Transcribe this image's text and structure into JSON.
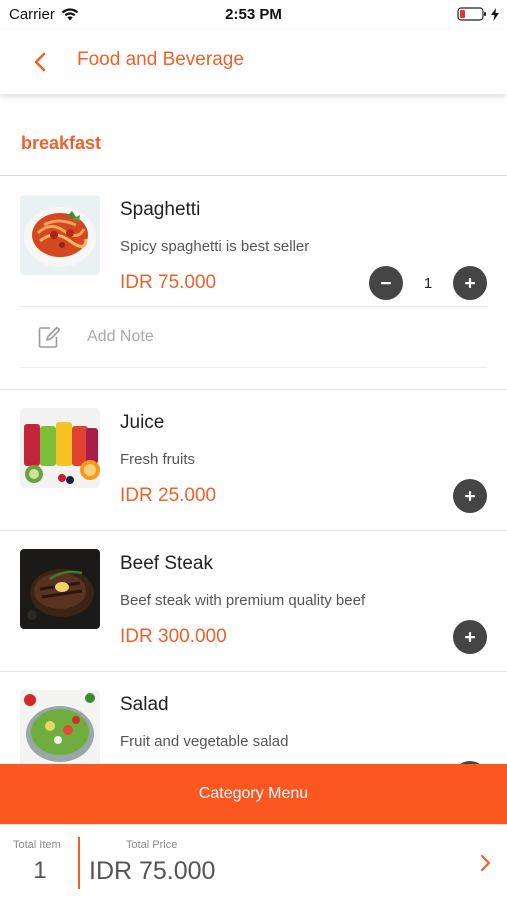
{
  "status_bar": {
    "carrier": "Carrier",
    "time": "2:53 PM",
    "icons": [
      "wifi-icon",
      "battery-low-icon",
      "charging-bolt-icon"
    ]
  },
  "nav": {
    "back_icon": "chevron-left-icon",
    "title": "Food and Beverage"
  },
  "section": {
    "title": "breakfast"
  },
  "menu_items": [
    {
      "name": "Spaghetti",
      "description": "Spicy spaghetti is best seller",
      "price": "IDR 75.000",
      "quantity": "1",
      "note_placeholder": "Add Note",
      "image": "spaghetti-photo"
    },
    {
      "name": "Juice",
      "description": "Fresh fruits",
      "price": "IDR 25.000",
      "image": "juice-photo"
    },
    {
      "name": "Beef Steak",
      "description": "Beef steak with premium quality beef",
      "price": "IDR 300.000",
      "image": "beef-steak-photo"
    },
    {
      "name": "Salad",
      "description": "Fruit and vegetable salad",
      "price": "",
      "image": "salad-photo"
    }
  ],
  "category_bar": {
    "label": "Category Menu"
  },
  "totals": {
    "item_label": "Total Item",
    "item_value": "1",
    "price_label": "Total Price",
    "price_value": "IDR 75.000"
  },
  "colors": {
    "accent": "#f0612a",
    "category_bar": "#fb5721",
    "round_button": "#454545"
  }
}
